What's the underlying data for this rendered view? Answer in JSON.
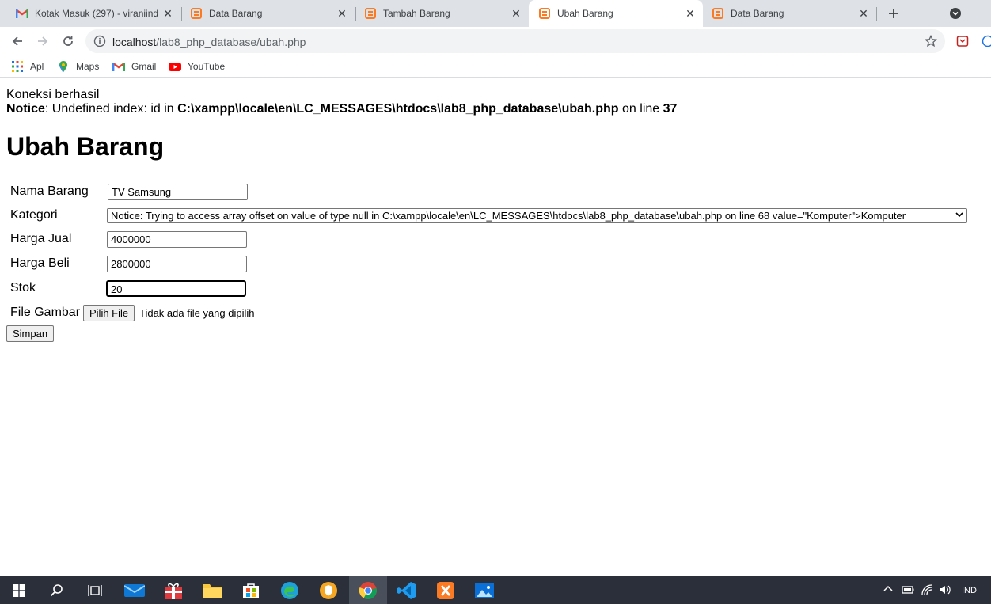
{
  "browser": {
    "tabs": [
      {
        "title": "Kotak Masuk (297) - viraniind",
        "icon": "gmail-icon"
      },
      {
        "title": "Data Barang",
        "icon": "xampp-icon"
      },
      {
        "title": "Tambah Barang",
        "icon": "xampp-icon"
      },
      {
        "title": "Ubah Barang",
        "icon": "xampp-icon",
        "active": true
      },
      {
        "title": "Data Barang",
        "icon": "xampp-icon"
      }
    ],
    "url_host": "localhost",
    "url_path": "/lab8_php_database/ubah.php",
    "bookmarks": [
      {
        "label": "Apl",
        "icon": "apps-grid-icon"
      },
      {
        "label": "Maps",
        "icon": "maps-icon"
      },
      {
        "label": "Gmail",
        "icon": "gmail-icon"
      },
      {
        "label": "YouTube",
        "icon": "youtube-icon"
      }
    ]
  },
  "page": {
    "connection_msg": "Koneksi berhasil",
    "notice_label": "Notice",
    "notice_text_1": ": Undefined index: id in ",
    "notice_path": "C:\\xampp\\locale\\en\\LC_MESSAGES\\htdocs\\lab8_php_database\\ubah.php",
    "notice_text_2": " on line ",
    "notice_line": "37",
    "heading": "Ubah Barang",
    "form": {
      "nama_label": "Nama Barang",
      "nama_value": "TV Samsung",
      "kategori_label": "Kategori",
      "kategori_value": "Notice: Trying to access array offset on value of type null in C:\\xampp\\locale\\en\\LC_MESSAGES\\htdocs\\lab8_php_database\\ubah.php on line 68 value=\"Komputer\">Komputer",
      "harga_jual_label": "Harga Jual",
      "harga_jual_value": "4000000",
      "harga_beli_label": "Harga Beli",
      "harga_beli_value": "2800000",
      "stok_label": "Stok",
      "stok_value": "20",
      "file_label": "File Gambar",
      "file_button": "Pilih File",
      "file_status": "Tidak ada file yang dipilih",
      "submit": "Simpan"
    }
  },
  "taskbar": {
    "language": "IND"
  },
  "colors": {
    "tabstrip": "#dee1e6",
    "xampp": "#fb7a24",
    "taskbar": "#2b2f3a"
  }
}
